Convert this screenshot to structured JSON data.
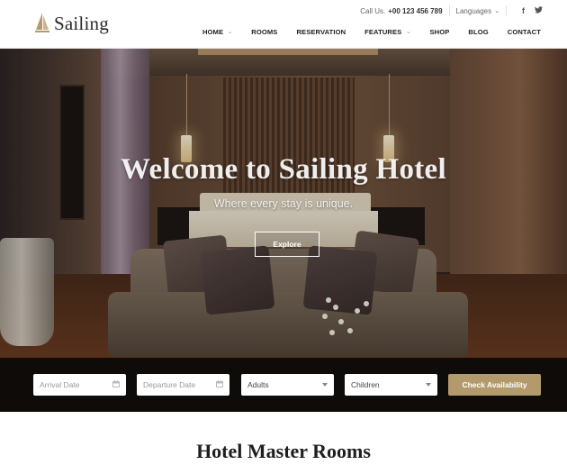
{
  "brand": {
    "name": "Sailing",
    "logo_icon": "sail-icon",
    "accent_color": "#b39a6c"
  },
  "topbar": {
    "call_label": "Call Us.",
    "call_number": "+00 123 456 789",
    "languages_label": "Languages",
    "social_icons": [
      "facebook-icon",
      "twitter-icon"
    ]
  },
  "nav": {
    "items": [
      {
        "label": "HOME",
        "has_dropdown": true
      },
      {
        "label": "ROOMS",
        "has_dropdown": false
      },
      {
        "label": "RESERVATION",
        "has_dropdown": false
      },
      {
        "label": "FEATURES",
        "has_dropdown": true
      },
      {
        "label": "SHOP",
        "has_dropdown": false
      },
      {
        "label": "BLOG",
        "has_dropdown": false
      },
      {
        "label": "CONTACT",
        "has_dropdown": false
      }
    ]
  },
  "hero": {
    "title": "Welcome to Sailing Hotel",
    "subtitle": "Where every stay is unique.",
    "button_label": "Explore"
  },
  "booking": {
    "arrival_placeholder": "Arrival Date",
    "departure_placeholder": "Departure Date",
    "adults_value": "Adults",
    "children_value": "Children",
    "check_button": "Check Availability"
  },
  "section": {
    "title": "Hotel Master Rooms"
  }
}
